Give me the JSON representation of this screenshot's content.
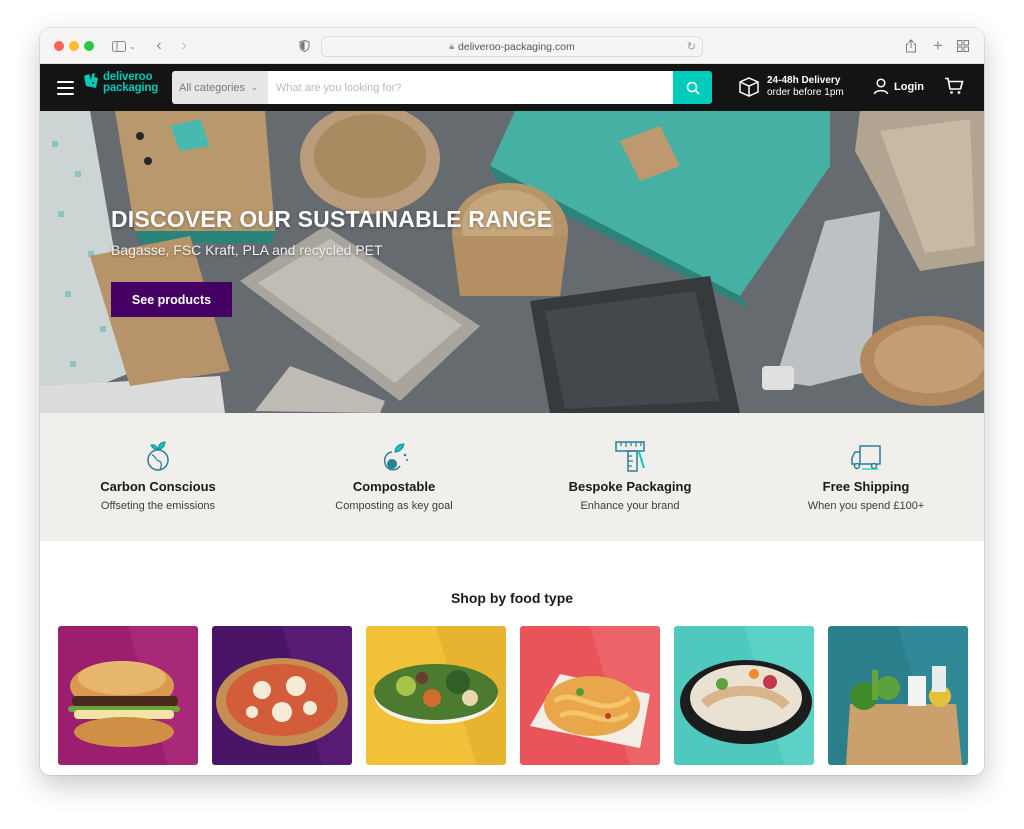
{
  "browser": {
    "url": "deliveroo-packaging.com"
  },
  "nav": {
    "logo_line1": "deliveroo",
    "logo_line2": "packaging",
    "category_label": "All categories",
    "search_placeholder": "What are you looking for?",
    "delivery_title": "24-48h Delivery",
    "delivery_sub": "order before 1pm",
    "login_label": "Login"
  },
  "hero": {
    "title": "DISCOVER OUR SUSTAINABLE RANGE",
    "subtitle": "Bagasse, FSC Kraft, PLA and recycled PET",
    "cta_label": "See products"
  },
  "features": [
    {
      "icon": "globe-leaf-icon",
      "title": "Carbon Conscious",
      "subtitle": "Offseting the emissions"
    },
    {
      "icon": "compost-icon",
      "title": "Compostable",
      "subtitle": "Composting as key goal"
    },
    {
      "icon": "ruler-icon",
      "title": "Bespoke Packaging",
      "subtitle": "Enhance your brand"
    },
    {
      "icon": "truck-icon",
      "title": "Free Shipping",
      "subtitle": "When you spend £100+"
    }
  ],
  "shop": {
    "heading": "Shop by food type",
    "tiles": [
      {
        "name": "burger-tile",
        "color": "#9b1f6e"
      },
      {
        "name": "pizza-tile",
        "color": "#4a1566"
      },
      {
        "name": "salad-bowl-tile",
        "color": "#f2c13a"
      },
      {
        "name": "pasta-tile",
        "color": "#e8545a"
      },
      {
        "name": "poke-bowl-tile",
        "color": "#4fc9be"
      },
      {
        "name": "groceries-tile",
        "color": "#2b7f8c"
      }
    ]
  },
  "colors": {
    "brand_teal": "#00ccbc",
    "brand_purple": "#440063",
    "nav_bg": "#141414"
  }
}
